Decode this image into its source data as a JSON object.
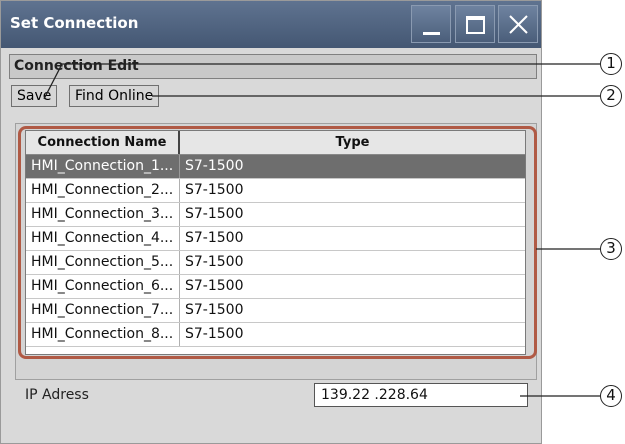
{
  "window": {
    "title": "Set Connection",
    "title_bar_color": "#4f6380"
  },
  "menu": {
    "label": "Connection Edit"
  },
  "toolbar": {
    "save_label": "Save",
    "find_online_label": "Find Online"
  },
  "table": {
    "columns": [
      "Connection Name",
      "Type"
    ],
    "selected_index": 0,
    "rows": [
      {
        "name": "HMI_Connection_1...",
        "type": "S7-1500"
      },
      {
        "name": "HMI_Connection_2...",
        "type": "S7-1500"
      },
      {
        "name": "HMI_Connection_3...",
        "type": "S7-1500"
      },
      {
        "name": "HMI_Connection_4...",
        "type": "S7-1500"
      },
      {
        "name": "HMI_Connection_5...",
        "type": "S7-1500"
      },
      {
        "name": "HMI_Connection_6...",
        "type": "S7-1500"
      },
      {
        "name": "HMI_Connection_7...",
        "type": "S7-1500"
      },
      {
        "name": "HMI_Connection_8...",
        "type": "S7-1500"
      }
    ]
  },
  "ip": {
    "label": "IP Adress",
    "value": "139.22 .228.64"
  },
  "callouts": [
    "1",
    "2",
    "3",
    "4"
  ],
  "highlight_color": "#b05a45"
}
